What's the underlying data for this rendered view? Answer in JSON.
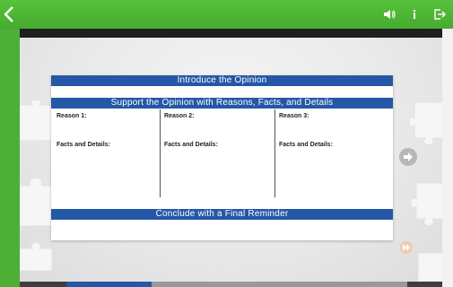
{
  "worksheet": {
    "intro_heading": "Introduce the Opinion",
    "support_heading": "Support the Opinion with Reasons, Facts, and Details",
    "conclude_heading": "Conclude with a Final Reminder",
    "columns": [
      {
        "reason": "Reason 1:",
        "details": "Facts and Details:"
      },
      {
        "reason": "Reason 2:",
        "details": "Facts and Details:"
      },
      {
        "reason": "Reason 3:",
        "details": "Facts and Details:"
      }
    ]
  },
  "progress": {
    "fraction": 0.25
  },
  "colors": {
    "green": "#4daf35",
    "blue": "#2557a7",
    "accent": "#f1c9b2"
  },
  "icons": {
    "back": "back-chevron-icon",
    "audio": "speaker-icon",
    "info": "info-icon",
    "exit": "exit-icon",
    "next": "next-arrow-icon",
    "fast_forward": "fast-forward-icon"
  }
}
